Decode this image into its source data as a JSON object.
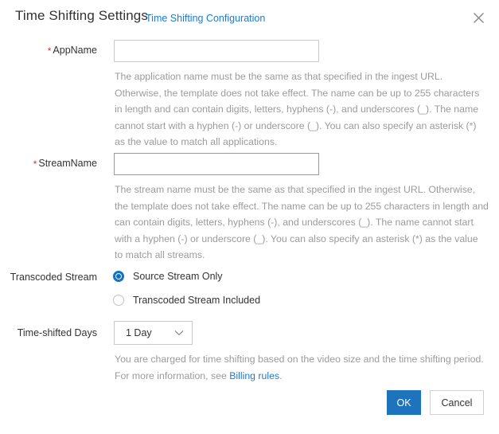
{
  "header": {
    "title": "Time Shifting Settings",
    "subtitle_link": "Time Shifting Configuration",
    "close_icon": "close-icon"
  },
  "form": {
    "app_name": {
      "label": "AppName",
      "required": true,
      "required_marker": "*",
      "value": "",
      "placeholder": "",
      "help": "The application name must be the same as that specified in the ingest URL. Otherwise, the template does not take effect. The name can be up to 255 characters in length and can contain digits, letters, hyphens (-), and underscores (_). The name cannot start with a hyphen (-) or underscore (_). You can also specify an asterisk (*) as the value to match all applications."
    },
    "stream_name": {
      "label": "StreamName",
      "required": true,
      "required_marker": "*",
      "value": "",
      "placeholder": "",
      "help": "The stream name must be the same as that specified in the ingest URL. Otherwise, the template does not take effect. The name can be up to 255 characters in length and can contain digits, letters, hyphens (-), and underscores (_). The name cannot start with a hyphen (-) or underscore (_). You can also specify an asterisk (*) as the value to match all streams."
    },
    "transcoded_stream": {
      "label": "Transcoded Stream",
      "options": [
        {
          "label": "Source Stream Only",
          "selected": true
        },
        {
          "label": "Transcoded Stream Included",
          "selected": false
        }
      ]
    },
    "time_shifted_days": {
      "label": "Time-shifted Days",
      "selected": "1 Day",
      "chevron_icon": "chevron-down-icon",
      "help_prefix": "You are charged for time shifting based on the video size and the time shifting period. For more information, see ",
      "help_link": "Billing rules",
      "help_suffix": "."
    }
  },
  "footer": {
    "ok_label": "OK",
    "cancel_label": "Cancel"
  },
  "colors": {
    "accent": "#1d74bd",
    "link": "#1f7ad4",
    "required": "#d93026",
    "help_text": "#9b9b9b",
    "radio_selected": "#0a6fc2"
  }
}
